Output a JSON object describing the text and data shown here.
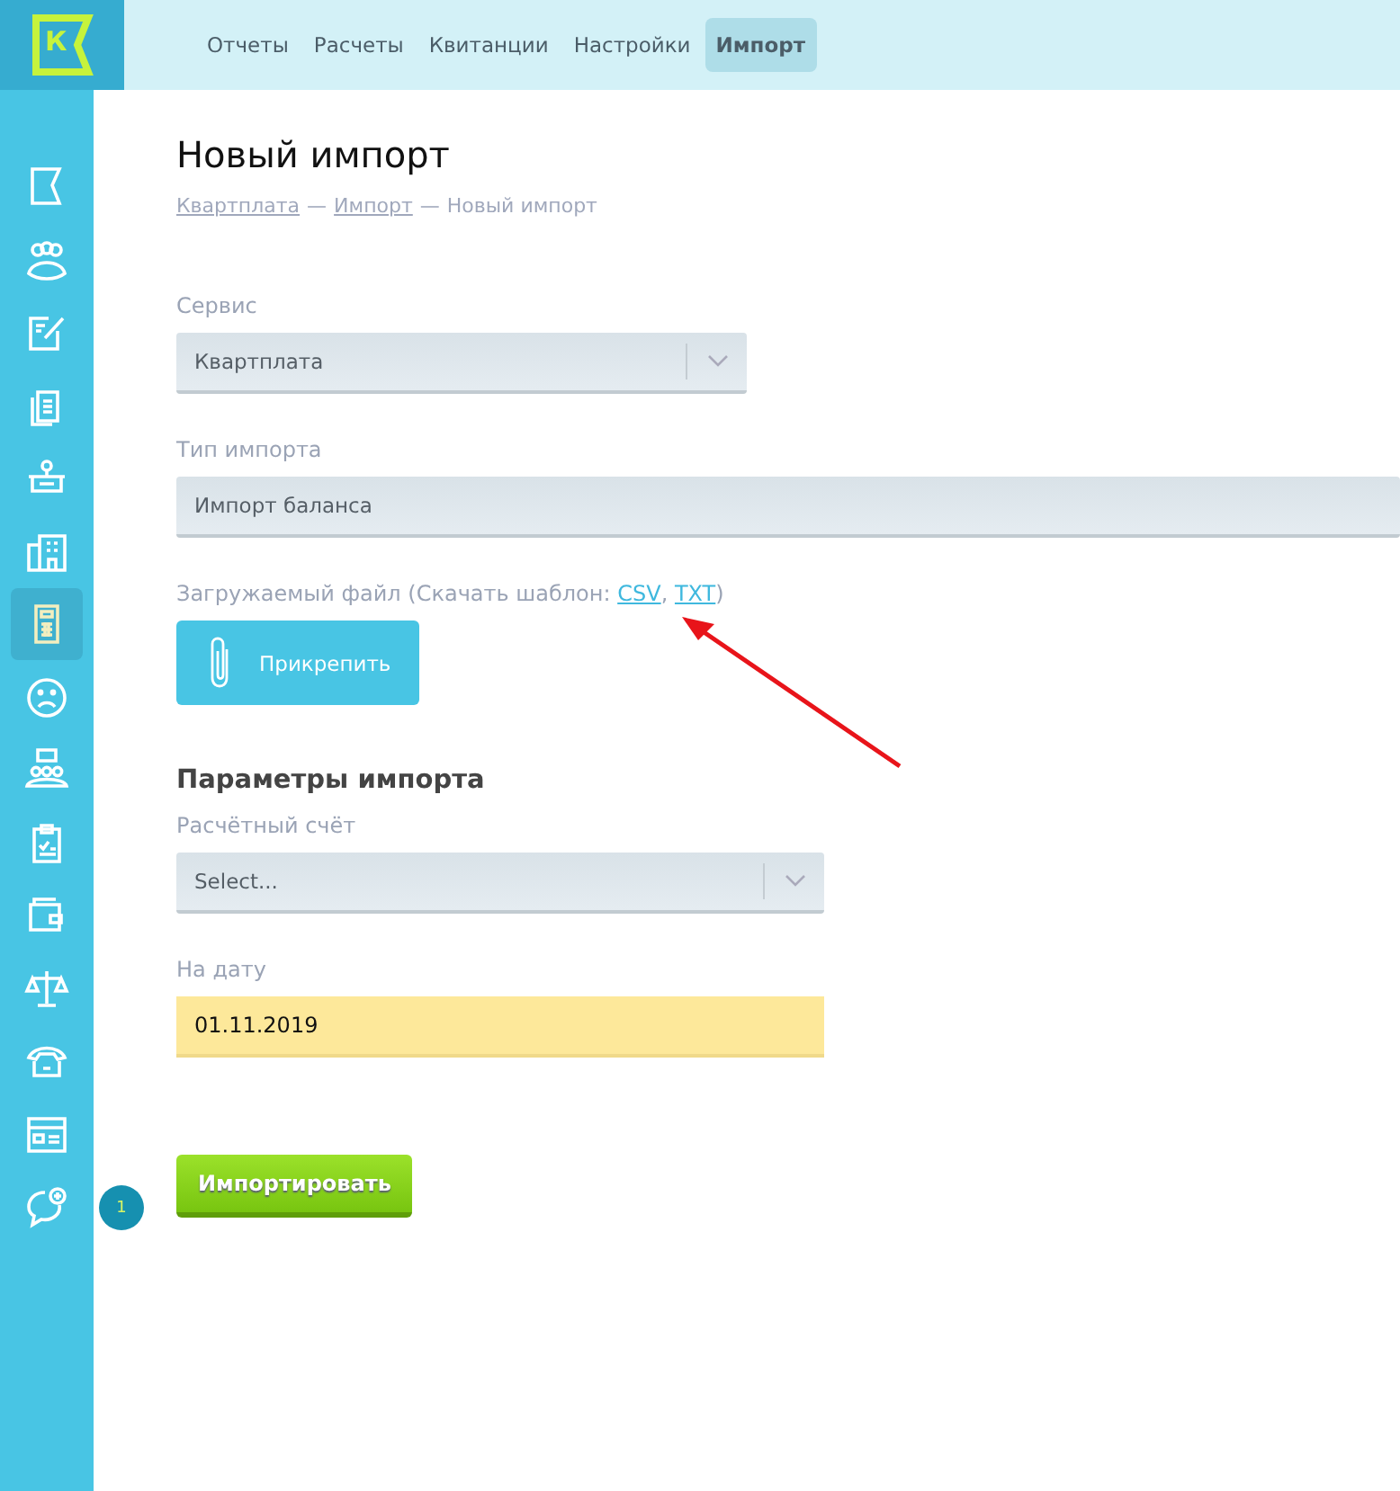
{
  "nav": [
    {
      "label": "Отчеты",
      "selected": false
    },
    {
      "label": "Расчеты",
      "selected": false
    },
    {
      "label": "Квитанции",
      "selected": false
    },
    {
      "label": "Настройки",
      "selected": false
    },
    {
      "label": "Импорт",
      "selected": true
    }
  ],
  "logo": {
    "letter": "К"
  },
  "sidebar": {
    "items": [
      {
        "kind": "flag",
        "selected": false
      },
      {
        "kind": "people",
        "selected": false
      },
      {
        "kind": "edit",
        "selected": false
      },
      {
        "kind": "docs",
        "selected": false
      },
      {
        "kind": "desk",
        "selected": false
      },
      {
        "kind": "building",
        "selected": false
      },
      {
        "kind": "calculator",
        "selected": true
      },
      {
        "kind": "sad",
        "selected": false
      },
      {
        "kind": "meeting",
        "selected": false
      },
      {
        "kind": "clipboard",
        "selected": false
      },
      {
        "kind": "wallet",
        "selected": false
      },
      {
        "kind": "scales",
        "selected": false
      },
      {
        "kind": "phone",
        "selected": false
      },
      {
        "kind": "window",
        "selected": false
      },
      {
        "kind": "chat",
        "selected": false,
        "badge": "1"
      }
    ]
  },
  "page": {
    "title": "Новый импорт",
    "breadcrumbs": [
      {
        "label": "Квартплата",
        "link": true
      },
      {
        "label": "Импорт",
        "link": true
      },
      {
        "label": "Новый импорт",
        "link": false
      }
    ],
    "separator": "—"
  },
  "form": {
    "service": {
      "label": "Сервис",
      "value": "Квартплата"
    },
    "import_type": {
      "label": "Тип импорта",
      "value": "Импорт баланса"
    },
    "file": {
      "label": "Загружаемый файл (Скачать шаблон: ",
      "links": [
        "CSV",
        "TXT"
      ],
      "link_separator": ",",
      "close": ")",
      "button": "Прикрепить"
    },
    "section": "Параметры импорта",
    "account": {
      "label": "Расчётный счёт",
      "placeholder": "Select..."
    },
    "date": {
      "label": "На дату",
      "value": "01.11.2019"
    },
    "submit": "Импортировать"
  }
}
